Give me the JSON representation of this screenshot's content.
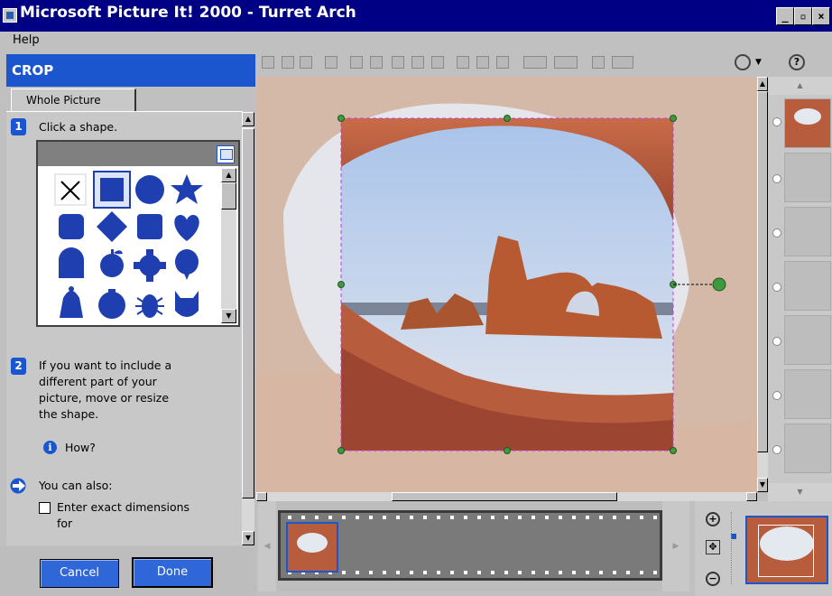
{
  "window": {
    "title": "Microsoft Picture It! 2000 - Turret Arch"
  },
  "menu": {
    "help": "Help"
  },
  "panel": {
    "header": "CROP",
    "tab": "Whole Picture",
    "step1": {
      "num": "1",
      "text": "Click a shape."
    },
    "step2": {
      "num": "2",
      "text_lines": [
        "If you want to include a",
        "different part of your",
        "picture, move or resize",
        "the shape."
      ]
    },
    "how": "How?",
    "also": "You can also:",
    "checkbox_lines": [
      "Enter exact dimensions",
      "for"
    ],
    "cancel": "Cancel",
    "done": "Done"
  },
  "shapes": [
    "x",
    "square",
    "circle",
    "star",
    "rounded-square",
    "diamond",
    "rounded-square-2",
    "heart",
    "arch",
    "apple",
    "gear",
    "balloon",
    "bell",
    "shield",
    "bug",
    "cat"
  ],
  "colors": {
    "titlebar": "#000084",
    "accent": "#1c56cf",
    "shape": "#1f3fb0",
    "crop_line": "#c23be0",
    "handle": "#3f9a3f"
  }
}
